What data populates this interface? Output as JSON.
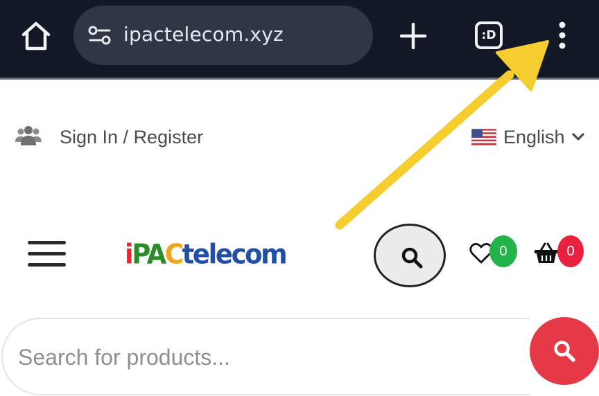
{
  "browser": {
    "url": "ipactelecom.xyz",
    "tab_switcher_label": ":D",
    "icons": [
      "home-icon",
      "site-settings-icon",
      "plus-icon",
      "tab-switcher-icon",
      "more-vert-icon"
    ],
    "chrome_color": "#131826",
    "omnibox_color": "#2f3646"
  },
  "topbar": {
    "signin_label": "Sign In / Register",
    "language_label": "English",
    "icons": [
      "users-icon",
      "us-flag-icon",
      "chevron-down-icon"
    ]
  },
  "header": {
    "logo_parts": {
      "i": "i",
      "pa": "PA",
      "c": "C",
      "telecom": "telecom"
    },
    "wishlist_count": "0",
    "cart_count": "0",
    "icons": [
      "hamburger-icon",
      "search-icon",
      "heart-icon",
      "basket-icon"
    ],
    "colors": {
      "wishlist_badge": "#22b34a",
      "cart_badge": "#e9223f"
    }
  },
  "search": {
    "placeholder": "Search for products...",
    "value": "",
    "submit_color": "#e53a46"
  },
  "annotation": {
    "arrow_color": "#f6cd2f",
    "points_to": "more-vert-icon"
  }
}
